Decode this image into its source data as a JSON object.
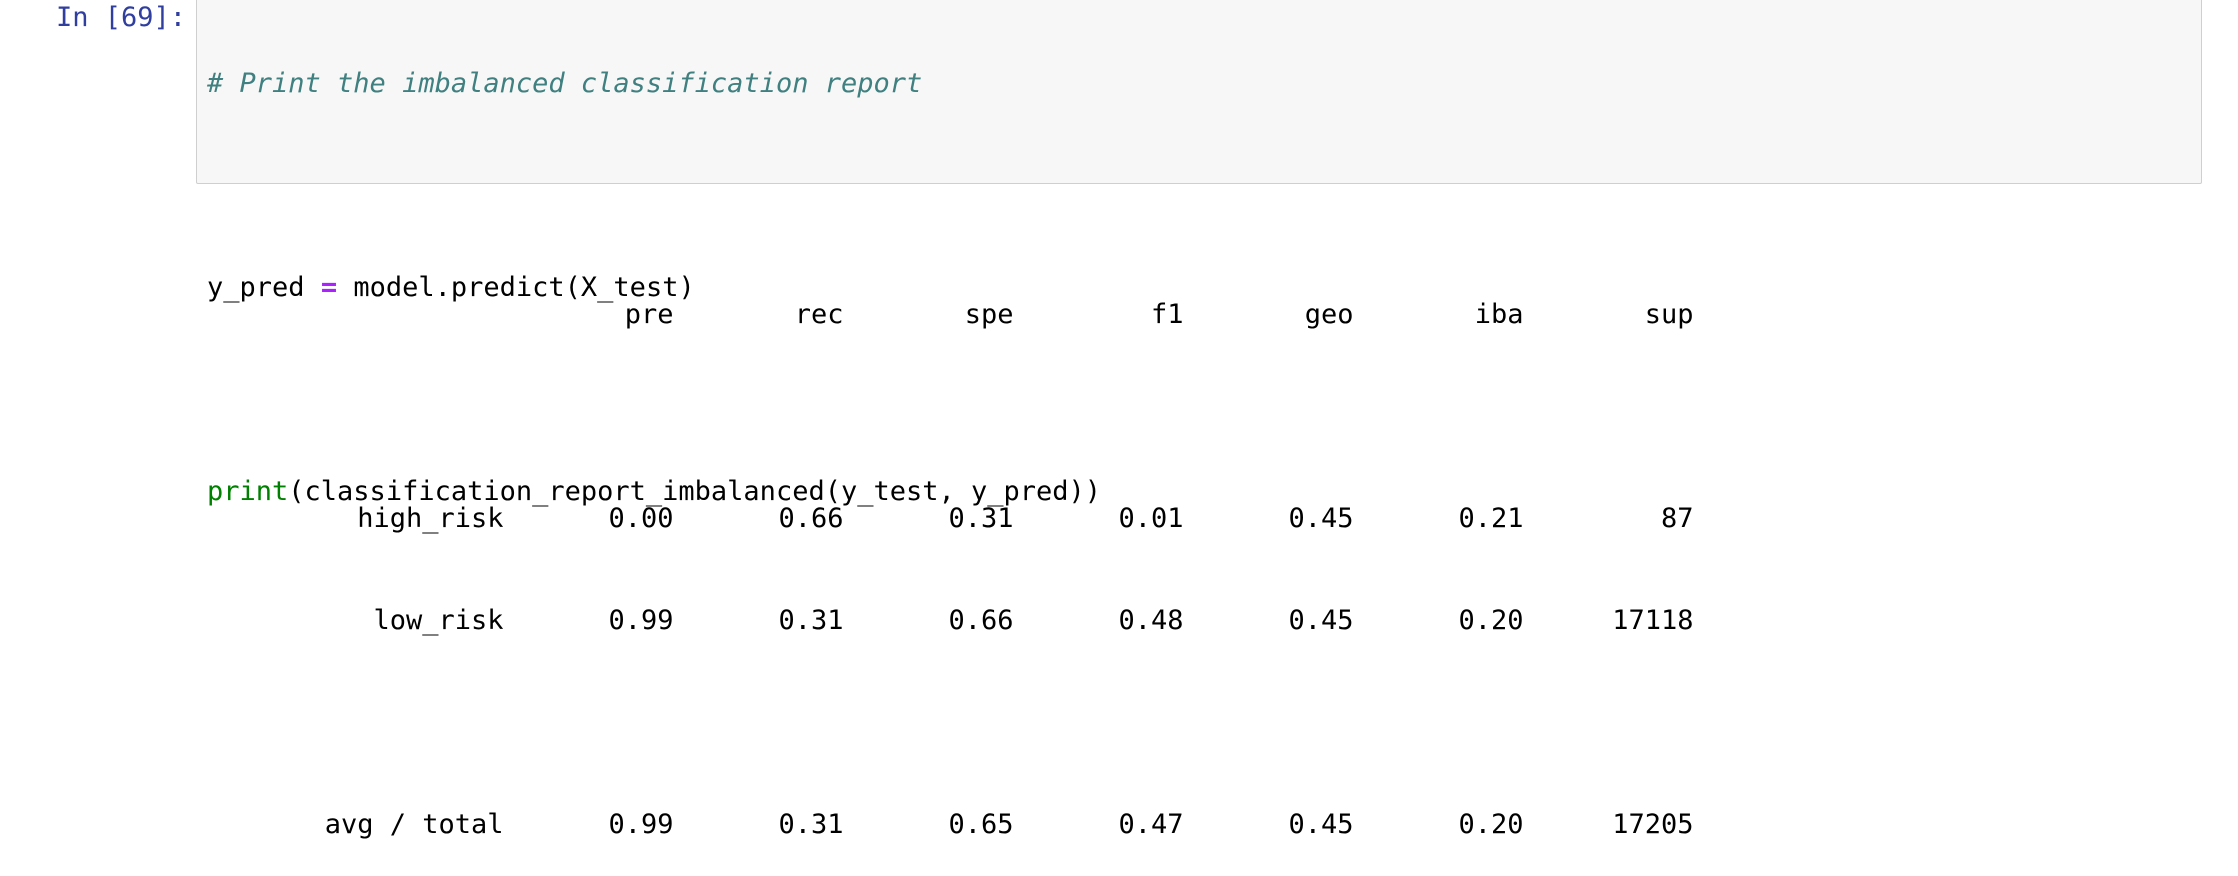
{
  "cell": {
    "prompt": "In [69]:",
    "code": {
      "comment": "# Print the imbalanced classification report",
      "line2_var": "y_pred",
      "line2_op": "=",
      "line2_rest": "model.predict(X_test)",
      "line3_builtin": "print",
      "line3_rest": "(classification_report_imbalanced(y_test, y_pred))"
    },
    "colors": {
      "prompt": "#303f9f",
      "comment": "#408080",
      "operator": "#aa22ff",
      "builtin": "#008000",
      "cell_background": "#f7f7f7",
      "cell_border": "#cfcfcf"
    }
  },
  "output": {
    "headers": [
      "pre",
      "rec",
      "spe",
      "f1",
      "geo",
      "iba",
      "sup"
    ],
    "rows": [
      {
        "label": "high_risk",
        "values": [
          "0.00",
          "0.66",
          "0.31",
          "0.01",
          "0.45",
          "0.21",
          "87"
        ]
      },
      {
        "label": "low_risk",
        "values": [
          "0.99",
          "0.31",
          "0.66",
          "0.48",
          "0.45",
          "0.20",
          "17118"
        ]
      }
    ],
    "total": {
      "label": "avg / total",
      "values": [
        "0.99",
        "0.31",
        "0.65",
        "0.47",
        "0.45",
        "0.20",
        "17205"
      ]
    }
  }
}
